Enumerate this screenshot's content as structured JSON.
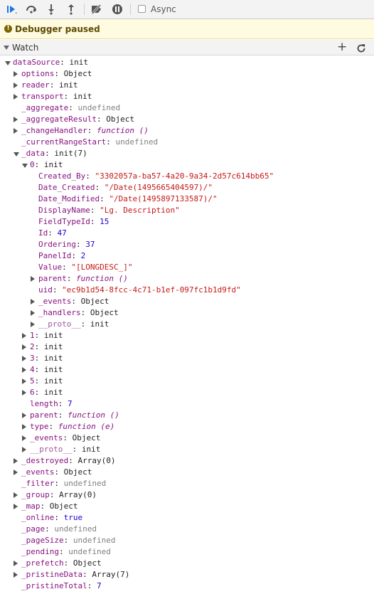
{
  "toolbar": {
    "buttons": [
      {
        "name": "resume-button",
        "icon": "resume-icon"
      },
      {
        "name": "step-over-button",
        "icon": "step-over-icon"
      },
      {
        "name": "step-into-button",
        "icon": "step-into-icon"
      },
      {
        "name": "step-out-button",
        "icon": "step-out-icon"
      },
      {
        "name": "deactivate-breakpoints-button",
        "icon": "breakpoints-off-icon"
      },
      {
        "name": "pause-on-exceptions-button",
        "icon": "pause-icon"
      }
    ],
    "async_label": "Async",
    "async_checked": false
  },
  "banner": {
    "text": "Debugger paused"
  },
  "watch": {
    "title": "Watch",
    "add_icon": "plus-icon",
    "refresh_icon": "refresh-icon"
  },
  "colors": {
    "key": "#881280",
    "string": "#c41a16",
    "number": "#1c00cf",
    "undefined": "#808080",
    "banner_bg": "#fffbe0",
    "toolbar_accent": "#1a73e8"
  },
  "rows": [
    {
      "d": 0,
      "x": "down",
      "k": "dataSource",
      "v": "init",
      "t": "obj"
    },
    {
      "d": 1,
      "x": "right",
      "k": "options",
      "v": "Object",
      "t": "obj"
    },
    {
      "d": 1,
      "x": "right",
      "k": "reader",
      "v": "init",
      "t": "obj"
    },
    {
      "d": 1,
      "x": "right",
      "k": "transport",
      "v": "init",
      "t": "obj"
    },
    {
      "d": 1,
      "x": "none",
      "k": "_aggregate",
      "v": "undefined",
      "t": "und"
    },
    {
      "d": 1,
      "x": "right",
      "k": "_aggregateResult",
      "v": "Object",
      "t": "obj"
    },
    {
      "d": 1,
      "x": "right",
      "k": "_changeHandler",
      "v": "function ()",
      "t": "fn"
    },
    {
      "d": 1,
      "x": "none",
      "k": "_currentRangeStart",
      "v": "undefined",
      "t": "und"
    },
    {
      "d": 1,
      "x": "down",
      "k": "_data",
      "v": "init(7)",
      "t": "obj"
    },
    {
      "d": 2,
      "x": "down",
      "k": "0",
      "v": "init",
      "t": "obj"
    },
    {
      "d": 3,
      "x": "none",
      "k": "Created_By",
      "v": "\"3302057a-ba57-4a20-9a34-2d57c614bb65\"",
      "t": "str"
    },
    {
      "d": 3,
      "x": "none",
      "k": "Date_Created",
      "v": "\"/Date(1495665404597)/\"",
      "t": "str"
    },
    {
      "d": 3,
      "x": "none",
      "k": "Date_Modified",
      "v": "\"/Date(1495897133587)/\"",
      "t": "str"
    },
    {
      "d": 3,
      "x": "none",
      "k": "DisplayName",
      "v": "\"Lg. Description\"",
      "t": "str"
    },
    {
      "d": 3,
      "x": "none",
      "k": "FieldTypeId",
      "v": "15",
      "t": "num"
    },
    {
      "d": 3,
      "x": "none",
      "k": "Id",
      "v": "47",
      "t": "num"
    },
    {
      "d": 3,
      "x": "none",
      "k": "Ordering",
      "v": "37",
      "t": "num"
    },
    {
      "d": 3,
      "x": "none",
      "k": "PanelId",
      "v": "2",
      "t": "num"
    },
    {
      "d": 3,
      "x": "none",
      "k": "Value",
      "v": "\"[LONGDESC_]\"",
      "t": "str"
    },
    {
      "d": 3,
      "x": "right",
      "k": "parent",
      "v": "function ()",
      "t": "fn"
    },
    {
      "d": 3,
      "x": "none",
      "k": "uid",
      "v": "\"ec9b1d54-8fcc-4c71-b1ef-097fc1b1d9fd\"",
      "t": "str"
    },
    {
      "d": 3,
      "x": "right",
      "k": "_events",
      "v": "Object",
      "t": "obj"
    },
    {
      "d": 3,
      "x": "right",
      "k": "_handlers",
      "v": "Object",
      "t": "obj"
    },
    {
      "d": 3,
      "x": "right",
      "k": "__proto__",
      "v": "init",
      "t": "obj",
      "dim": true
    },
    {
      "d": 2,
      "x": "right",
      "k": "1",
      "v": "init",
      "t": "obj"
    },
    {
      "d": 2,
      "x": "right",
      "k": "2",
      "v": "init",
      "t": "obj"
    },
    {
      "d": 2,
      "x": "right",
      "k": "3",
      "v": "init",
      "t": "obj"
    },
    {
      "d": 2,
      "x": "right",
      "k": "4",
      "v": "init",
      "t": "obj"
    },
    {
      "d": 2,
      "x": "right",
      "k": "5",
      "v": "init",
      "t": "obj"
    },
    {
      "d": 2,
      "x": "right",
      "k": "6",
      "v": "init",
      "t": "obj"
    },
    {
      "d": 2,
      "x": "none",
      "k": "length",
      "v": "7",
      "t": "num"
    },
    {
      "d": 2,
      "x": "right",
      "k": "parent",
      "v": "function ()",
      "t": "fn"
    },
    {
      "d": 2,
      "x": "right",
      "k": "type",
      "v": "function (e)",
      "t": "fn"
    },
    {
      "d": 2,
      "x": "right",
      "k": "_events",
      "v": "Object",
      "t": "obj"
    },
    {
      "d": 2,
      "x": "right",
      "k": "__proto__",
      "v": "init",
      "t": "obj",
      "dim": true
    },
    {
      "d": 1,
      "x": "right",
      "k": "_destroyed",
      "v": "Array(0)",
      "t": "obj"
    },
    {
      "d": 1,
      "x": "right",
      "k": "_events",
      "v": "Object",
      "t": "obj"
    },
    {
      "d": 1,
      "x": "none",
      "k": "_filter",
      "v": "undefined",
      "t": "und"
    },
    {
      "d": 1,
      "x": "right",
      "k": "_group",
      "v": "Array(0)",
      "t": "obj"
    },
    {
      "d": 1,
      "x": "right",
      "k": "_map",
      "v": "Object",
      "t": "obj"
    },
    {
      "d": 1,
      "x": "none",
      "k": "_online",
      "v": "true",
      "t": "bool"
    },
    {
      "d": 1,
      "x": "none",
      "k": "_page",
      "v": "undefined",
      "t": "und"
    },
    {
      "d": 1,
      "x": "none",
      "k": "_pageSize",
      "v": "undefined",
      "t": "und"
    },
    {
      "d": 1,
      "x": "none",
      "k": "_pending",
      "v": "undefined",
      "t": "und"
    },
    {
      "d": 1,
      "x": "right",
      "k": "_prefetch",
      "v": "Object",
      "t": "obj"
    },
    {
      "d": 1,
      "x": "right",
      "k": "_pristineData",
      "v": "Array(7)",
      "t": "obj"
    },
    {
      "d": 1,
      "x": "none",
      "k": "_pristineTotal",
      "v": "7",
      "t": "num"
    }
  ]
}
